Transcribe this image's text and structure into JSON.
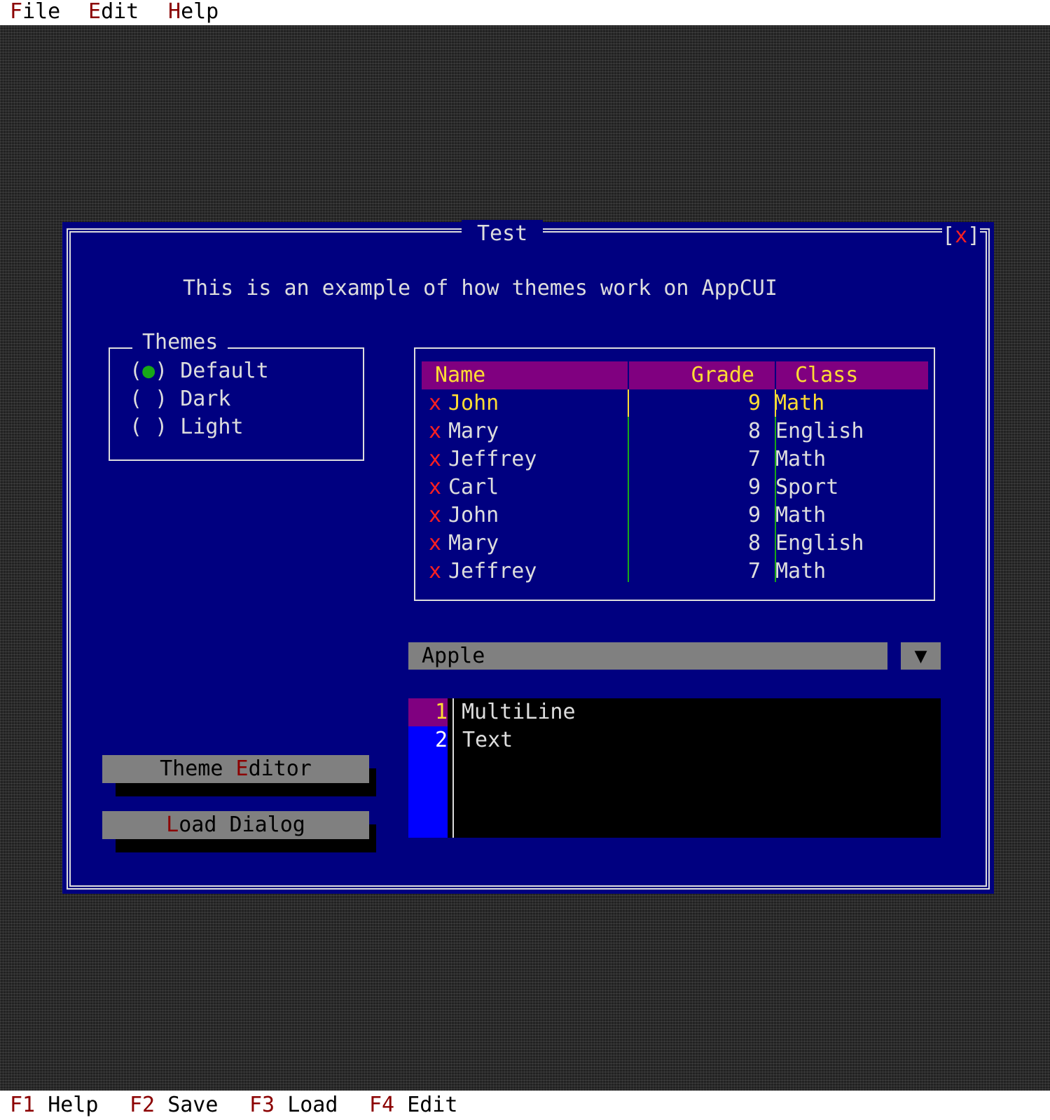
{
  "menubar": {
    "items": [
      {
        "hotkey": "F",
        "rest": "ile"
      },
      {
        "hotkey": "E",
        "rest": "dit"
      },
      {
        "hotkey": "H",
        "rest": "elp"
      }
    ]
  },
  "window": {
    "title": "Test",
    "close_glyph": "x",
    "description": "This is an example of how themes work on AppCUI",
    "themes": {
      "title": "Themes",
      "options": [
        {
          "mark": "●",
          "label": "Default",
          "selected": true
        },
        {
          "mark": " ",
          "label": "Dark",
          "selected": false
        },
        {
          "mark": " ",
          "label": "Light",
          "selected": false
        }
      ]
    },
    "table": {
      "columns": [
        "Name",
        "Grade",
        "Class"
      ],
      "row_marker": "x",
      "rows": [
        {
          "name": "John",
          "grade": "9",
          "class": "Math"
        },
        {
          "name": "Mary",
          "grade": "8",
          "class": "English"
        },
        {
          "name": "Jeffrey",
          "grade": "7",
          "class": "Math"
        },
        {
          "name": "Carl",
          "grade": "9",
          "class": "Sport"
        },
        {
          "name": "John",
          "grade": "9",
          "class": "Math"
        },
        {
          "name": "Mary",
          "grade": "8",
          "class": "English"
        },
        {
          "name": "Jeffrey",
          "grade": "7",
          "class": "Math"
        }
      ]
    },
    "combobox": {
      "value": "Apple",
      "arrow": "▼"
    },
    "textarea": {
      "lines": [
        {
          "number": "1",
          "text": "MultiLine"
        },
        {
          "number": "2",
          "text": "Text"
        }
      ]
    },
    "buttons": {
      "theme_editor": {
        "before": "Theme ",
        "hotkey": "E",
        "after": "ditor"
      },
      "load_dialog": {
        "before": "",
        "hotkey": "L",
        "after": "oad Dialog"
      }
    }
  },
  "cmdbar": {
    "items": [
      {
        "key": "F1",
        "label": "Help"
      },
      {
        "key": "F2",
        "label": "Save"
      },
      {
        "key": "F3",
        "label": "Load"
      },
      {
        "key": "F4",
        "label": "Edit"
      }
    ]
  },
  "colors": {
    "window_bg": "#000080",
    "header_bg": "#800080",
    "combobox_bg": "#808080",
    "textarea_bg": "#000000",
    "gutter_bg": "#0000ff",
    "hotkey": "#8b0000",
    "selected_text": "#ffdd33",
    "row_marker": "#ff2020"
  }
}
